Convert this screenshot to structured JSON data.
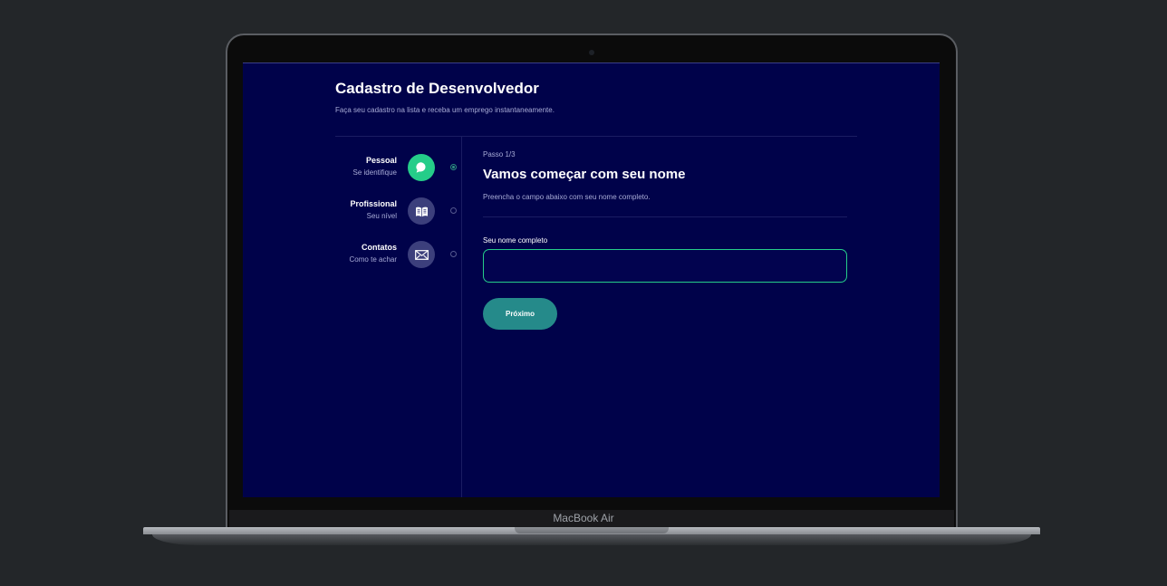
{
  "device": {
    "model_label": "MacBook Air"
  },
  "header": {
    "title": "Cadastro de Desenvolvedor",
    "subtitle": "Faça seu cadastro na lista e receba um emprego instantaneamente."
  },
  "steps": [
    {
      "title": "Pessoal",
      "desc": "Se identifique",
      "icon": "chat-bubble-icon",
      "active": true
    },
    {
      "title": "Profissional",
      "desc": "Seu nível",
      "icon": "open-book-icon",
      "active": false
    },
    {
      "title": "Contatos",
      "desc": "Como te achar",
      "icon": "mail-envelope-icon",
      "active": false
    }
  ],
  "form": {
    "step_counter": "Passo 1/3",
    "title": "Vamos começar com seu nome",
    "description": "Preencha o campo abaixo com seu nome completo.",
    "name_label": "Seu nome completo",
    "name_value": "",
    "next_label": "Próximo"
  },
  "colors": {
    "background": "#00024a",
    "accent": "#25cd89",
    "button": "#258a8a",
    "muted_text": "#a7abd6"
  }
}
